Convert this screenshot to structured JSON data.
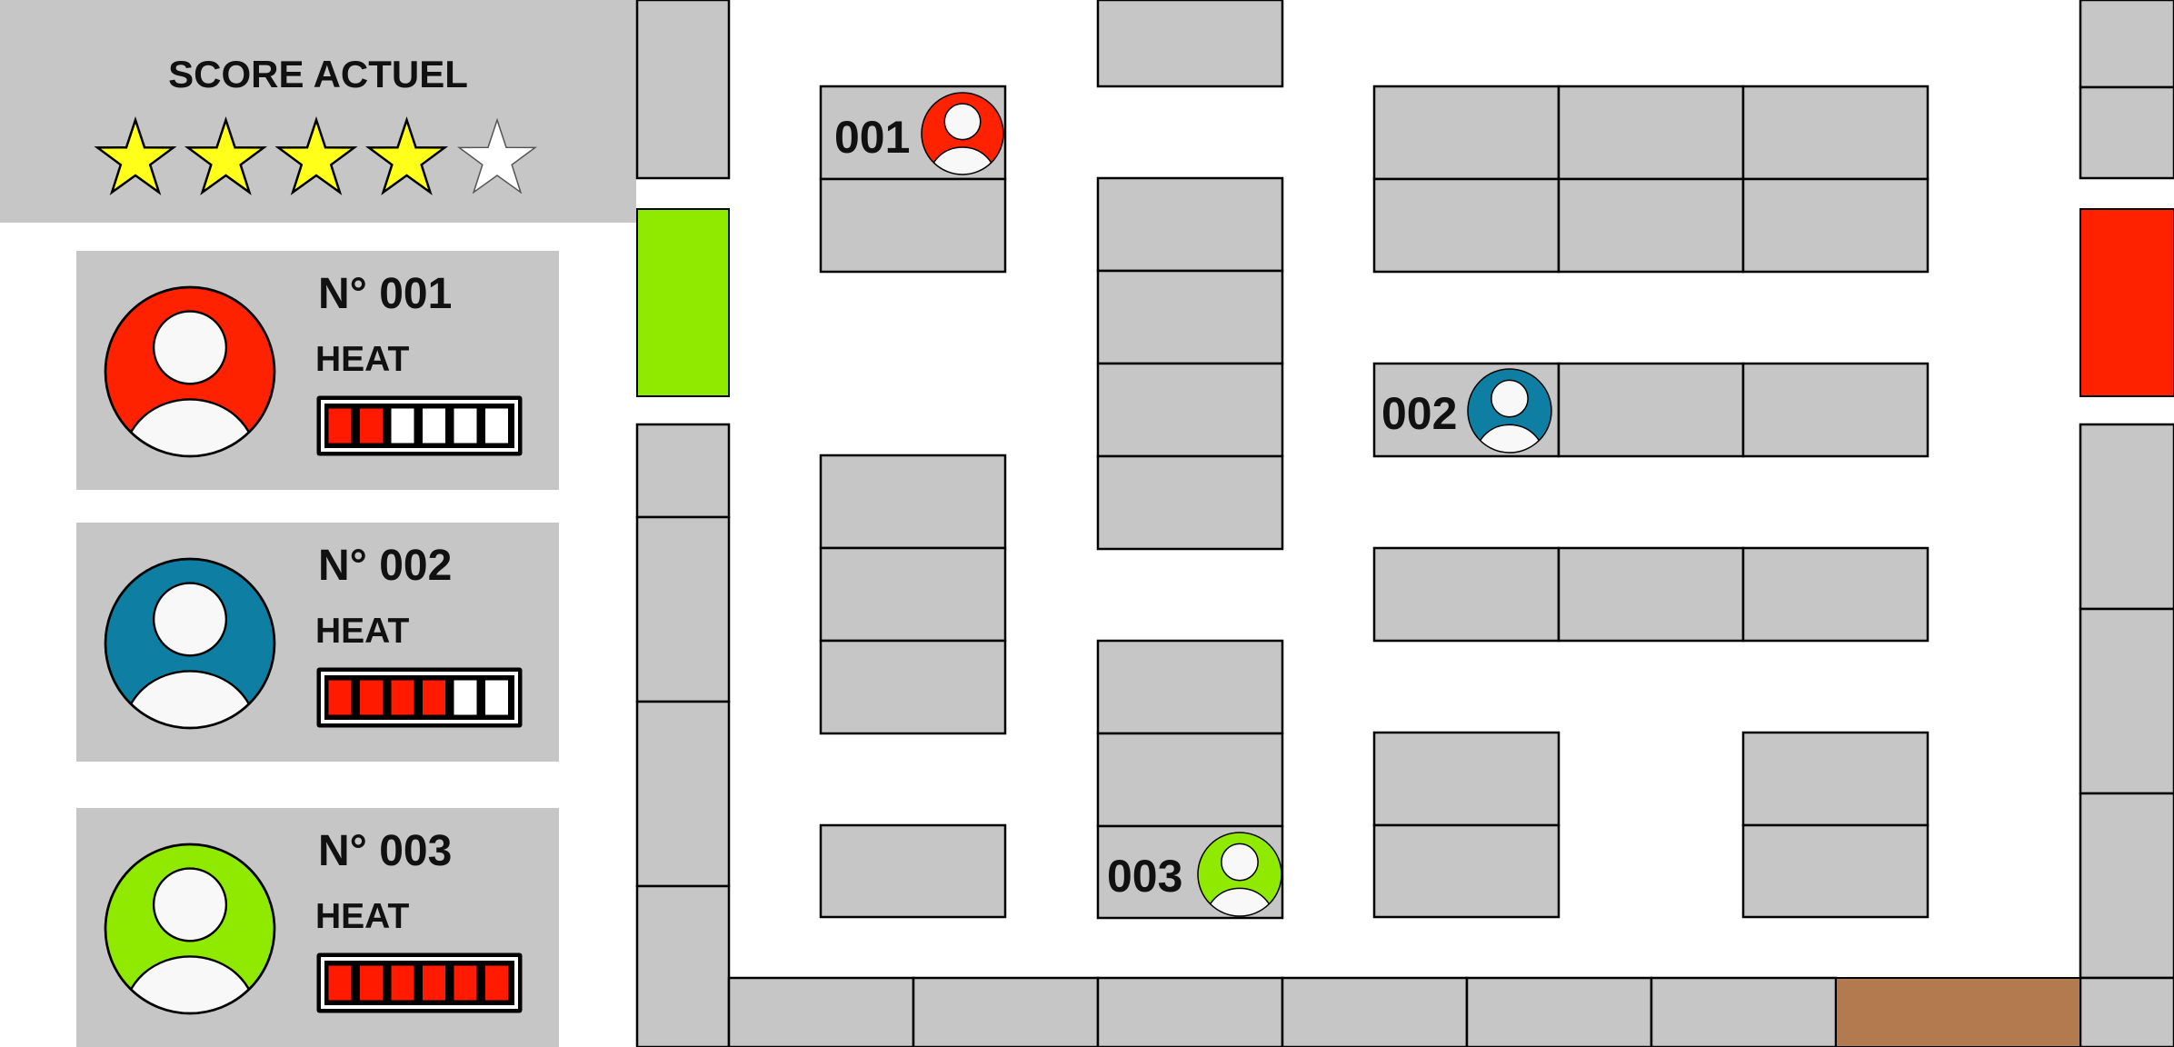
{
  "score": {
    "title": "SCORE ACTUEL",
    "stars_filled": 4,
    "stars_total": 5,
    "star_fill_color": "#ffff1a"
  },
  "players": [
    {
      "id": "001",
      "card_title": "N° 001",
      "heat_label": "HEAT",
      "heat_level": 2,
      "color": "#ff2200"
    },
    {
      "id": "002",
      "card_title": "N° 002",
      "heat_label": "HEAT",
      "heat_level": 4,
      "color": "#0e7fa3"
    },
    {
      "id": "003",
      "card_title": "N° 003",
      "heat_label": "HEAT",
      "heat_level": 6,
      "color": "#8fea00"
    }
  ],
  "heat_segments": 6,
  "heat_on_color": "#ff1a00",
  "colors": {
    "floor": "#ffffff",
    "shelf": "#c6c6c6",
    "entrance": "#8fea00",
    "exit": "#ff2200",
    "door": "#b27a4e"
  }
}
